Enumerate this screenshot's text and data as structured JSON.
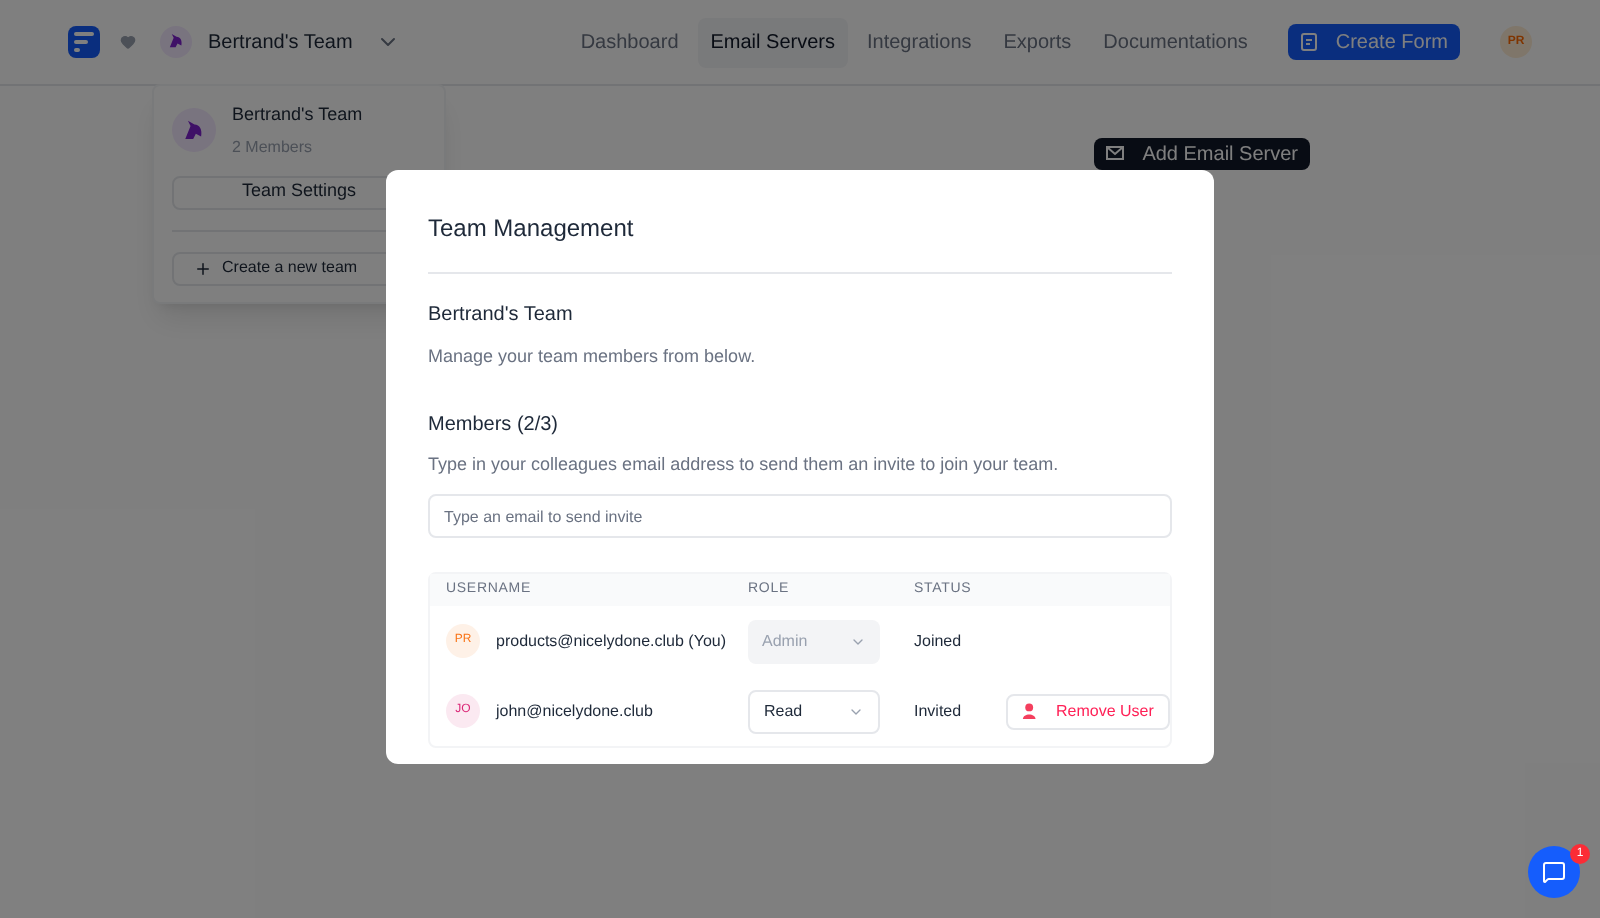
{
  "header": {
    "team_name": "Bertrand's Team",
    "nav": [
      {
        "label": "Dashboard",
        "selected": false
      },
      {
        "label": "Email Servers",
        "selected": true
      },
      {
        "label": "Integrations",
        "selected": false
      },
      {
        "label": "Exports",
        "selected": false
      },
      {
        "label": "Documentations",
        "selected": false
      }
    ],
    "create_button": "Create Form",
    "user_initials": "PR"
  },
  "team_menu": {
    "team_name": "Bertrand's Team",
    "members": "2 Members",
    "settings_button": "Team Settings",
    "create_button": "Create a new team"
  },
  "page": {
    "add_button": "Add Email Server"
  },
  "modal": {
    "title": "Team Management",
    "team_name": "Bertrand's Team",
    "team_description": "Manage your team members from below.",
    "members_title": "Members (2/3)",
    "members_description": "Type in your colleagues email address to send them an invite to join your team.",
    "invite_placeholder": "Type an email to send invite",
    "columns": [
      "USERNAME",
      "ROLE",
      "STATUS"
    ],
    "rows": [
      {
        "initials": "PR",
        "color": "#f97316",
        "username": "products@nicelydone.club (You)",
        "role": "Admin",
        "role_disabled": true,
        "status": "Joined"
      },
      {
        "initials": "JO",
        "color": "#db2777",
        "username": "john@nicelydone.club",
        "role": "Read",
        "role_disabled": false,
        "status": "Invited",
        "action": "Remove User"
      }
    ]
  },
  "chat": {
    "badge": "1"
  }
}
